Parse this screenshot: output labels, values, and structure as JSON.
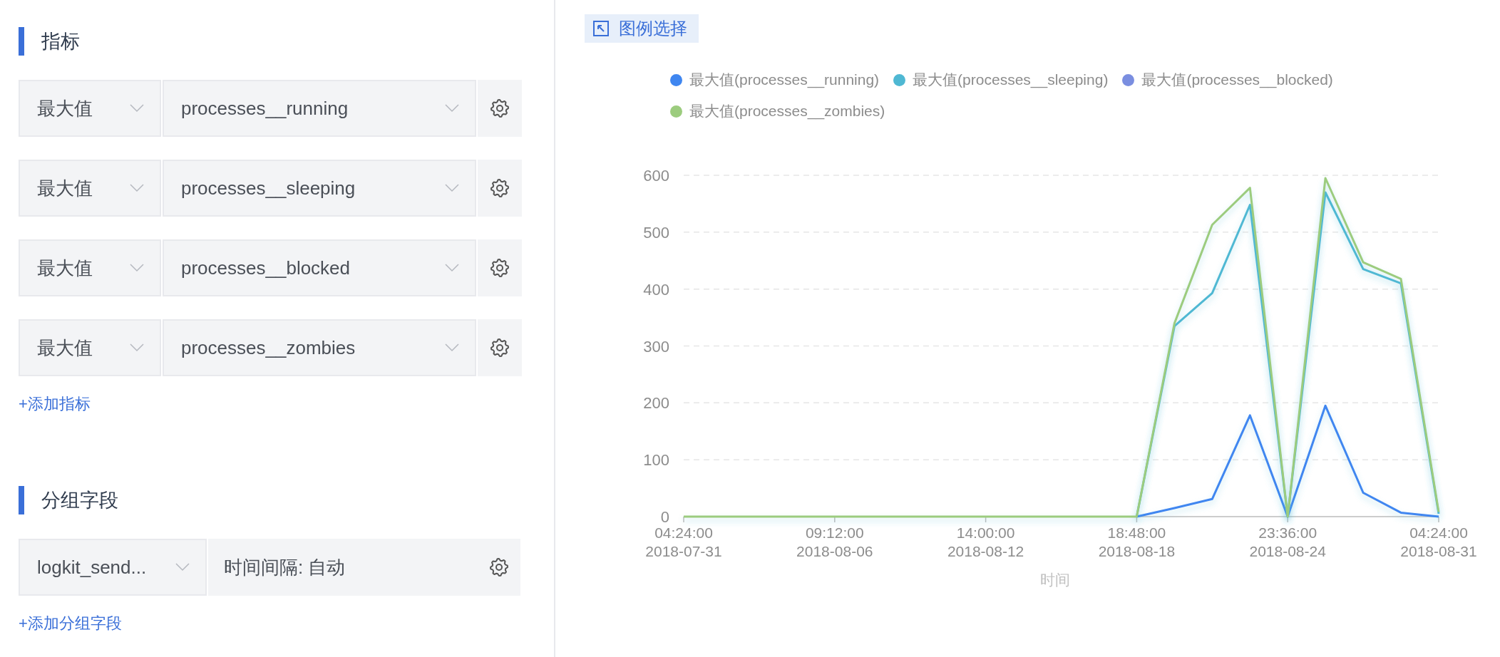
{
  "metrics": {
    "title": "指标",
    "rows": [
      {
        "aggregate": "最大值",
        "field": "processes__running"
      },
      {
        "aggregate": "最大值",
        "field": "processes__sleeping"
      },
      {
        "aggregate": "最大值",
        "field": "processes__blocked"
      },
      {
        "aggregate": "最大值",
        "field": "processes__zombies"
      }
    ],
    "add_link": "+添加指标"
  },
  "group_by": {
    "title": "分组字段",
    "field": "logkit_send...",
    "interval": "时间间隔: 自动",
    "add_link": "+添加分组字段"
  },
  "chart_panel": {
    "legend_button": "图例选择",
    "chart_data": {
      "type": "line",
      "xlabel": "时间",
      "categories": [
        "04:24:00\n2018-07-31",
        null,
        null,
        null,
        "09:12:00\n2018-08-06",
        null,
        null,
        null,
        "14:00:00\n2018-08-12",
        null,
        null,
        null,
        "18:48:00\n2018-08-18",
        null,
        null,
        null,
        "23:36:00\n2018-08-24",
        null,
        null,
        null,
        "04:24:00\n2018-08-31"
      ],
      "ylim": [
        0,
        600
      ],
      "grid": true,
      "yticks": [
        0,
        100,
        200,
        300,
        400,
        500,
        600
      ],
      "series": [
        {
          "name": "最大值(processes__running)",
          "color": "#3f86f0",
          "values": [
            null,
            null,
            null,
            null,
            null,
            null,
            null,
            null,
            null,
            null,
            null,
            null,
            0,
            15,
            31,
            178,
            0,
            195,
            42,
            7,
            0
          ]
        },
        {
          "name": "最大值(processes__sleeping)",
          "color": "#4fb8d3",
          "values": [
            null,
            null,
            null,
            null,
            null,
            null,
            null,
            null,
            null,
            null,
            null,
            null,
            0,
            335,
            393,
            548,
            0,
            570,
            435,
            410,
            5
          ]
        },
        {
          "name": "最大值(processes__blocked)",
          "color": "#7a8ee0",
          "values": [
            null,
            null,
            null,
            null,
            null,
            null,
            null,
            null,
            null,
            null,
            null,
            null,
            null,
            null,
            null,
            null,
            null,
            null,
            null,
            null,
            null
          ]
        },
        {
          "name": "最大值(processes__zombies)",
          "color": "#9ccc7e",
          "values": [
            0,
            0,
            0,
            0,
            0,
            0,
            0,
            0,
            0,
            0,
            0,
            0,
            0,
            340,
            513,
            578,
            0,
            595,
            447,
            418,
            8
          ]
        }
      ]
    }
  }
}
